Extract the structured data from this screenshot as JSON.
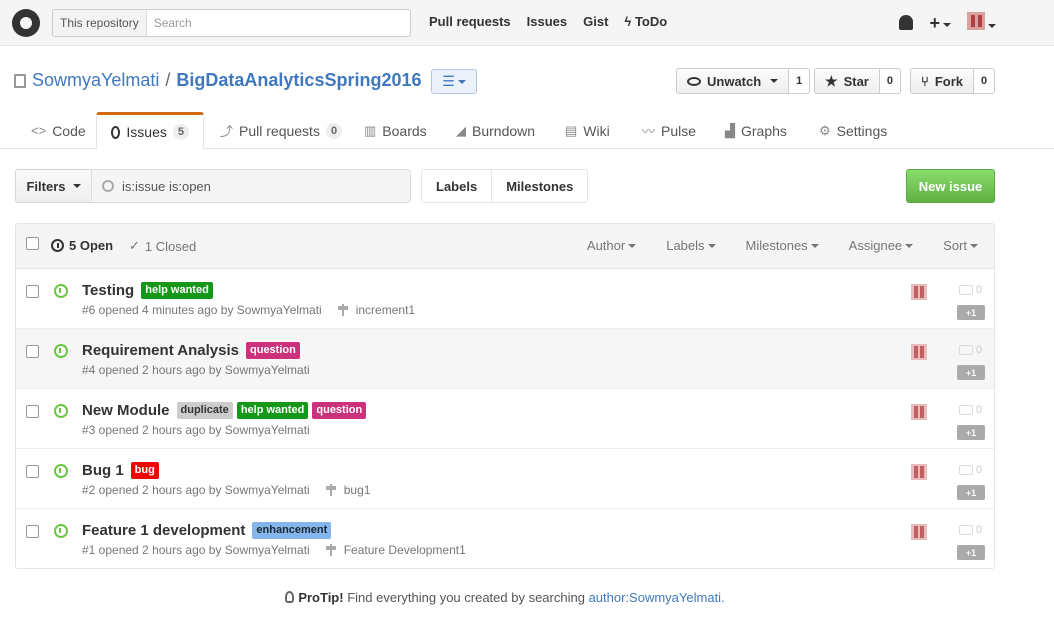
{
  "header": {
    "scope_label": "This repository",
    "search_placeholder": "Search",
    "nav": [
      "Pull requests",
      "Issues",
      "Gist",
      "ToDo"
    ],
    "plus": "+"
  },
  "repo": {
    "owner": "SowmyaYelmati",
    "slash": "/",
    "name": "BigDataAnalyticsSpring2016",
    "list_icon": "☰",
    "watch_label": "Unwatch",
    "watch_count": "1",
    "star_label": "Star",
    "star_count": "0",
    "fork_label": "Fork",
    "fork_count": "0"
  },
  "tabs": {
    "code": "Code",
    "issues": "Issues",
    "issues_count": "5",
    "pulls": "Pull requests",
    "pulls_count": "0",
    "boards": "Boards",
    "burndown": "Burndown",
    "wiki": "Wiki",
    "pulse": "Pulse",
    "graphs": "Graphs",
    "settings": "Settings"
  },
  "subnav": {
    "filters": "Filters",
    "query": "is:issue is:open",
    "labels": "Labels",
    "milestones": "Milestones",
    "new_issue": "New issue"
  },
  "list_header": {
    "open": "5 Open",
    "closed": "1 Closed",
    "filters": [
      "Author",
      "Labels",
      "Milestones",
      "Assignee",
      "Sort"
    ]
  },
  "issues": [
    {
      "title": "Testing",
      "labels": [
        {
          "text": "help wanted",
          "bg": "#159818",
          "fg": "#ffffff"
        }
      ],
      "meta": "#6 opened 4 minutes ago by SowmyaYelmati",
      "milestone": "increment1",
      "comments": "0",
      "plusone": "+1"
    },
    {
      "title": "Requirement Analysis",
      "labels": [
        {
          "text": "question",
          "bg": "#cc317c",
          "fg": "#ffffff"
        }
      ],
      "meta": "#4 opened 2 hours ago by SowmyaYelmati",
      "milestone": "",
      "comments": "0",
      "plusone": "+1"
    },
    {
      "title": "New Module",
      "labels": [
        {
          "text": "duplicate",
          "bg": "#cccccc",
          "fg": "#333333"
        },
        {
          "text": "help wanted",
          "bg": "#159818",
          "fg": "#ffffff"
        },
        {
          "text": "question",
          "bg": "#cc317c",
          "fg": "#ffffff"
        }
      ],
      "meta": "#3 opened 2 hours ago by SowmyaYelmati",
      "milestone": "",
      "comments": "0",
      "plusone": "+1"
    },
    {
      "title": "Bug 1",
      "labels": [
        {
          "text": "bug",
          "bg": "#ee0701",
          "fg": "#ffffff"
        }
      ],
      "meta": "#2 opened 2 hours ago by SowmyaYelmati",
      "milestone": "bug1",
      "comments": "0",
      "plusone": "+1"
    },
    {
      "title": "Feature 1 development",
      "labels": [
        {
          "text": "enhancement",
          "bg": "#84b6eb",
          "fg": "#1c2733"
        }
      ],
      "meta": "#1 opened 2 hours ago by SowmyaYelmati",
      "milestone": "Feature Development1",
      "comments": "0",
      "plusone": "+1"
    }
  ],
  "protip": {
    "label": "ProTip!",
    "text": "Find everything you created by searching",
    "link": "author:SowmyaYelmati."
  }
}
